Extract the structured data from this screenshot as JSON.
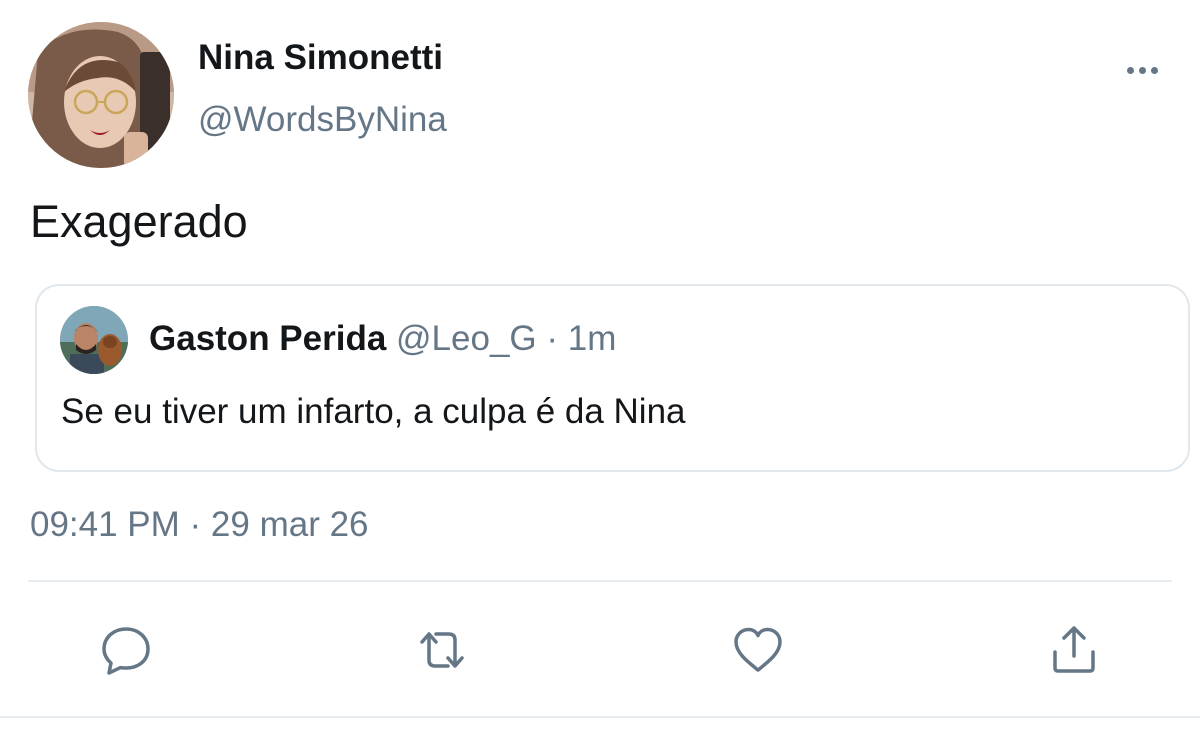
{
  "tweet": {
    "author": {
      "display_name": "Nina Simonetti",
      "handle": "@WordsByNina",
      "avatar": "user-photo"
    },
    "more_icon": "more-horizontal-icon",
    "text": "Exagerado",
    "timestamp": "09:41 PM · 29 mar 26"
  },
  "quoted_tweet": {
    "author": {
      "display_name": "Gaston Perida",
      "handle": "@Leo_G",
      "separator": "·",
      "time": "1m",
      "avatar": "user-photo"
    },
    "text": "Se eu tiver um infarto, a culpa é da Nina"
  },
  "actions": [
    {
      "name": "reply",
      "icon": "reply-icon"
    },
    {
      "name": "retweet",
      "icon": "retweet-icon"
    },
    {
      "name": "like",
      "icon": "heart-icon"
    },
    {
      "name": "share",
      "icon": "share-icon"
    }
  ],
  "colors": {
    "text_primary": "#14171a",
    "text_secondary": "#657786",
    "border": "#e1e8ed",
    "icon": "#657786"
  }
}
